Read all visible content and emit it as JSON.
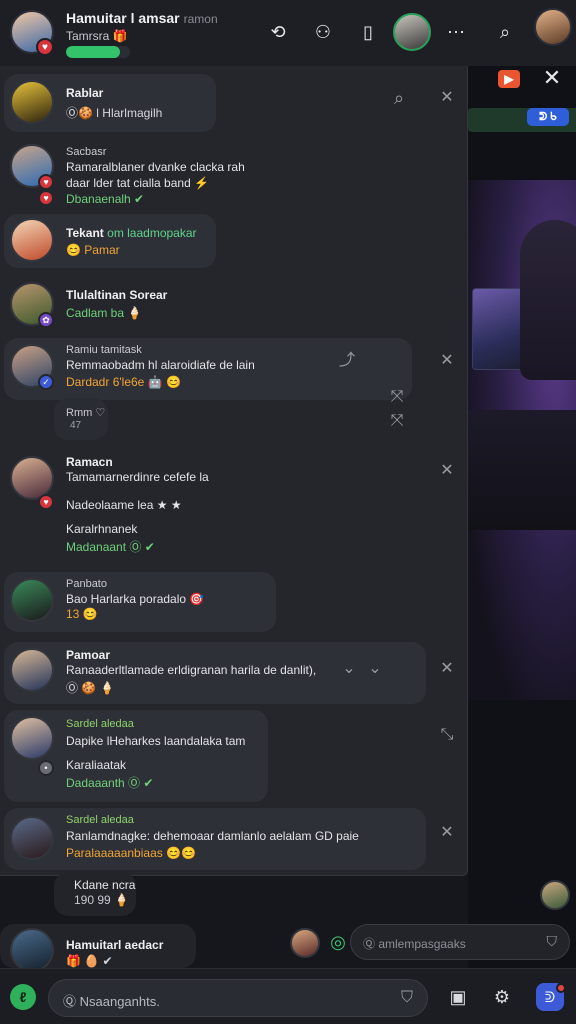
{
  "header": {
    "title": "Hamuitar l amsar",
    "title_suffix": "ramon",
    "subtitle": "Tamrsra",
    "subtitle_emoji": "🎁",
    "progress": 0.85,
    "icons": [
      "share-icon",
      "people-icon",
      "battery-icon",
      "more-icon",
      "search-icon"
    ]
  },
  "stream": {
    "live_label": "▶",
    "pill_label": "ᕲ ᑲ"
  },
  "notifications": [
    {
      "name": "Rablar",
      "text": "Ⓞ🍪 l Hlarlmagilh",
      "style": "compact"
    },
    {
      "name": "Sacbasr",
      "line1": "Ramaralblaner dvanke clacka rah",
      "line2": "daar lder tat cialla band ⚡",
      "meta": "Dbanaenalh ✔",
      "meta_color": "green"
    },
    {
      "name": "Tekant",
      "name_suffix": "om laadmopakar",
      "meta": "😊 Pamar",
      "meta_color": "orange"
    },
    {
      "name": "Tlulaltinan Sorear",
      "meta": "Cadlam ba 🍦",
      "meta_color": "green"
    },
    {
      "name": "Ramiu tamitask",
      "line1": "Remmaobadm hl alaroidiafe de lain",
      "meta": "Dardadr 6'le6e 🤖 😊",
      "meta_color": "orange"
    },
    {
      "name": "Rmm ♡",
      "line1": "47"
    },
    {
      "name": "Ramacn",
      "line1": "Tamamarnerdinre cefefe la",
      "line2": "Nadeolaame lea ★ ★",
      "line3": "Karalrhnanek",
      "meta": "Madanaant Ⓞ ✔",
      "meta_color": "green"
    },
    {
      "name": "Panbato",
      "line1": "Bao Harlarka poradalo 🎯",
      "meta": "13 😊",
      "meta_color": "orange"
    },
    {
      "name": "Pamoar",
      "line1": "Ranaaderltlamade erldigranan harila de danlit),",
      "meta": "Ⓞ 🍪 🍦",
      "meta_color": "white"
    },
    {
      "name": "Sardel aledaa",
      "line1": "Dapike lHeharkes laandalaka tam",
      "line2": "Karaliaatak",
      "meta": "Dadaaanth Ⓞ ✔",
      "meta_color": "green"
    },
    {
      "name": "Sardel aledaa",
      "line1": "Ranlamdnagke: dehemoaar damlanlo aelalam GD paie",
      "meta": "Paralaaaaanbiaas 😊😊",
      "meta_color": "orange"
    }
  ],
  "loose": [
    {
      "name": "Kdane ncra",
      "meta": "190 99 🍦"
    },
    {
      "name": "Hamuitarl aedacr",
      "meta": "🎁 🥚 ✔"
    }
  ],
  "chat_input": {
    "placeholder": "Ⓠ amlempasgaaks"
  },
  "bottom": {
    "mic_label": "ℓ",
    "input_placeholder": "Ⓠ Nsaanganhts.",
    "discord_label": "ᕲ"
  }
}
